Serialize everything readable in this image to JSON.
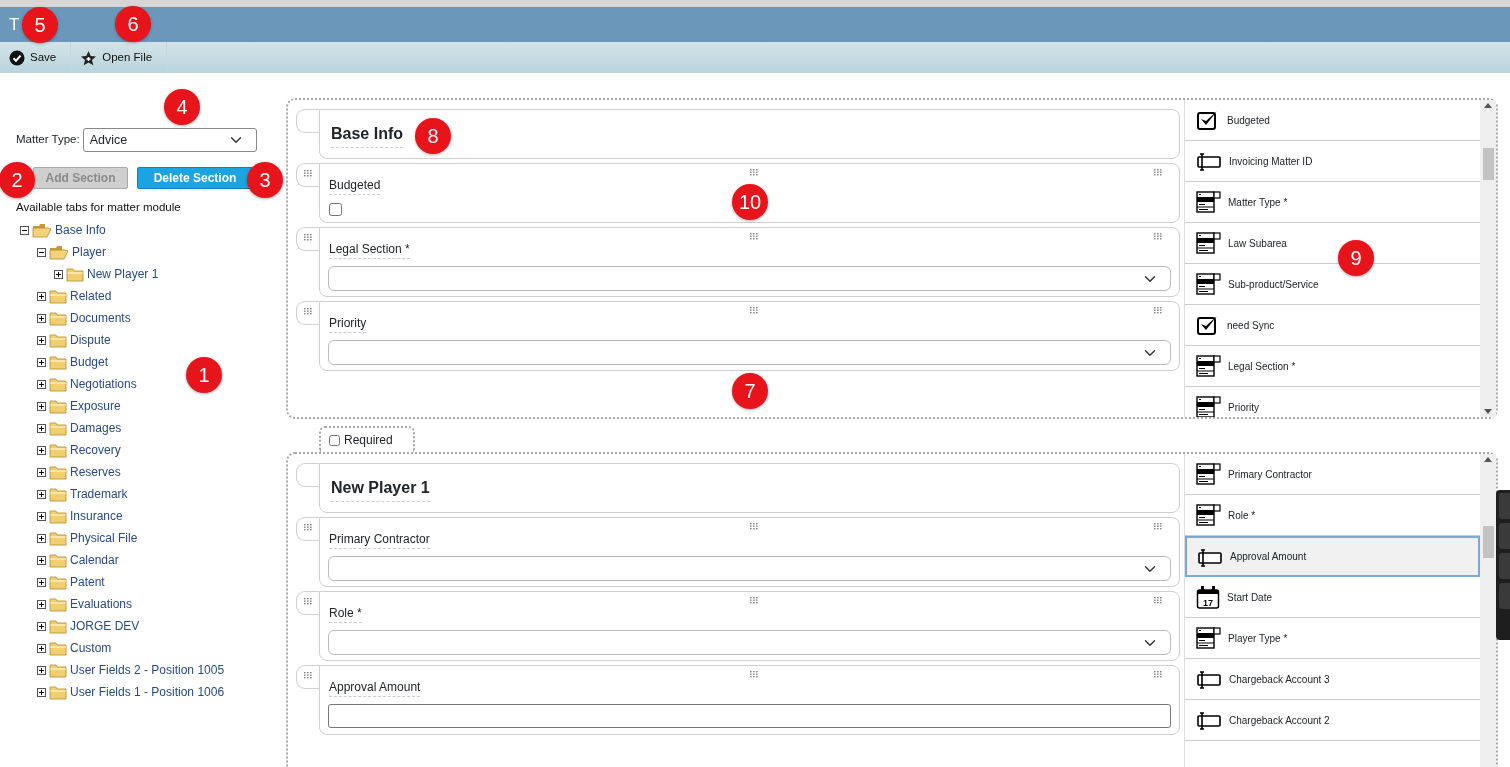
{
  "window": {
    "title": "T"
  },
  "toolbar": [
    {
      "label": "Save",
      "kind": "check"
    },
    {
      "label": "Open File",
      "kind": "star"
    }
  ],
  "matter_type": {
    "label": "Matter Type:",
    "value": "Advice"
  },
  "buttons": [
    {
      "label": "Add Section",
      "disabled": true
    },
    {
      "label": "Delete Section",
      "disabled": false
    }
  ],
  "tree": {
    "heading": "Available tabs for matter module",
    "items": [
      {
        "label": "Base Info",
        "expanded": true,
        "children": [
          {
            "label": "Player",
            "expanded": true,
            "children": [
              {
                "label": "New Player 1",
                "expanded": false
              }
            ]
          },
          {
            "label": "Related",
            "expanded": false
          },
          {
            "label": "Documents",
            "expanded": false
          },
          {
            "label": "Dispute",
            "expanded": false
          },
          {
            "label": "Budget",
            "expanded": false
          },
          {
            "label": "Negotiations",
            "expanded": false
          },
          {
            "label": "Exposure",
            "expanded": false
          },
          {
            "label": "Damages",
            "expanded": false
          },
          {
            "label": "Recovery",
            "expanded": false
          },
          {
            "label": "Reserves",
            "expanded": false
          },
          {
            "label": "Trademark",
            "expanded": false
          },
          {
            "label": "Insurance",
            "expanded": false
          },
          {
            "label": "Physical File",
            "expanded": false
          },
          {
            "label": "Calendar",
            "expanded": false
          },
          {
            "label": "Patent",
            "expanded": false
          },
          {
            "label": "Evaluations",
            "expanded": false
          },
          {
            "label": "JORGE DEV",
            "expanded": false
          },
          {
            "label": "Custom",
            "expanded": false
          },
          {
            "label": "User Fields 2 - Position 1005",
            "expanded": false
          },
          {
            "label": "User Fields 1 - Position 1006",
            "expanded": false
          }
        ]
      }
    ]
  },
  "sections": [
    {
      "title": "Base Info",
      "fields": [
        {
          "label": "Budgeted",
          "kind": "checkbox",
          "checked": false
        },
        {
          "label": "Legal Section *",
          "kind": "select"
        },
        {
          "label": "Priority",
          "kind": "select"
        }
      ],
      "palette": [
        {
          "label": "Budgeted",
          "kind": "checkbox",
          "selected": false
        },
        {
          "label": "Invoicing Matter ID",
          "kind": "text",
          "selected": false
        },
        {
          "label": "Matter Type *",
          "kind": "select",
          "selected": false
        },
        {
          "label": "Law Subarea",
          "kind": "select",
          "selected": false
        },
        {
          "label": "Sub-product/Service",
          "kind": "select",
          "selected": false
        },
        {
          "label": "need Sync",
          "kind": "checkbox",
          "selected": false
        },
        {
          "label": "Legal Section *",
          "kind": "select",
          "selected": false
        },
        {
          "label": "Priority",
          "kind": "select",
          "selected": false
        }
      ]
    },
    {
      "required": {
        "label": "Required",
        "checked": false
      },
      "title": "New Player 1",
      "fields": [
        {
          "label": "Primary Contractor",
          "kind": "select"
        },
        {
          "label": "Role *",
          "kind": "select"
        },
        {
          "label": "Approval Amount",
          "kind": "text"
        }
      ],
      "palette": [
        {
          "label": "Primary Contractor",
          "kind": "select",
          "selected": false
        },
        {
          "label": "Role *",
          "kind": "select",
          "selected": false
        },
        {
          "label": "Approval Amount",
          "kind": "text",
          "selected": true
        },
        {
          "label": "Start Date",
          "kind": "date",
          "icon_text": "17",
          "selected": false
        },
        {
          "label": "Player Type *",
          "kind": "select",
          "selected": false
        },
        {
          "label": "Chargeback Account 3",
          "kind": "text",
          "selected": false
        },
        {
          "label": "Chargeback Account 2",
          "kind": "text",
          "selected": false
        }
      ]
    }
  ],
  "callouts": [
    {
      "text": "1"
    },
    {
      "text": "2"
    },
    {
      "text": "3"
    },
    {
      "text": "4"
    },
    {
      "text": "5"
    },
    {
      "text": "6"
    },
    {
      "text": "7"
    },
    {
      "text": "8"
    },
    {
      "text": "9"
    },
    {
      "text": "10"
    }
  ]
}
